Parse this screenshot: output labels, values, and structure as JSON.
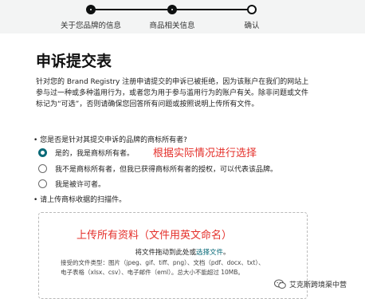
{
  "stepper": {
    "steps": [
      {
        "label": "关于您品牌的信息",
        "state": "done"
      },
      {
        "label": "商品相关信息",
        "state": "done"
      },
      {
        "label": "确认",
        "state": "current"
      }
    ]
  },
  "form": {
    "title": "申诉提交表",
    "intro": "针对您的 Brand Registry 注册申请提交的申诉已被拒绝，因为该账户在我们的网站上参与过一种或多种滥用行为，或者您为用于参与滥用行为的账户有关。除非问题或文件标记为“可选”，否则请确保您回答所有问题或按照说明上传所有文件。",
    "question": "• 您是否是针对其提交申诉的品牌的商标所有者?",
    "options": [
      {
        "label": "是的，我是商标所有者。",
        "selected": true
      },
      {
        "label": "我不是商标所有者，但我已获得商标所有者的授权，可以代表该品牌。",
        "selected": false
      },
      {
        "label": "我是被许可者。",
        "selected": false
      }
    ],
    "upload_label": "• 请上传商标收据的扫描件。",
    "drop_text_prefix": "将文件拖动到此处或",
    "drop_link": "选择文件",
    "drop_text_suffix": "。",
    "filetypes_line1": "接受的文件类型：图片（jpeg、gif、tiff、png）、文档（pdf、docx、txt）、",
    "filetypes_line2": "电子表格（xlsx、csv）、电子邮件（eml）。总大小不能超过 10MB。"
  },
  "annotations": {
    "select_hint": "根据实际情况进行选择",
    "upload_hint": "上传所有资料（文件用英文命名）"
  },
  "watermark": {
    "text": "艾克斯跨境渠中营"
  },
  "colors": {
    "accent": "#0a6a78",
    "annotation_red": "#e4302b",
    "stepper_bg": "#f3f4f4"
  }
}
